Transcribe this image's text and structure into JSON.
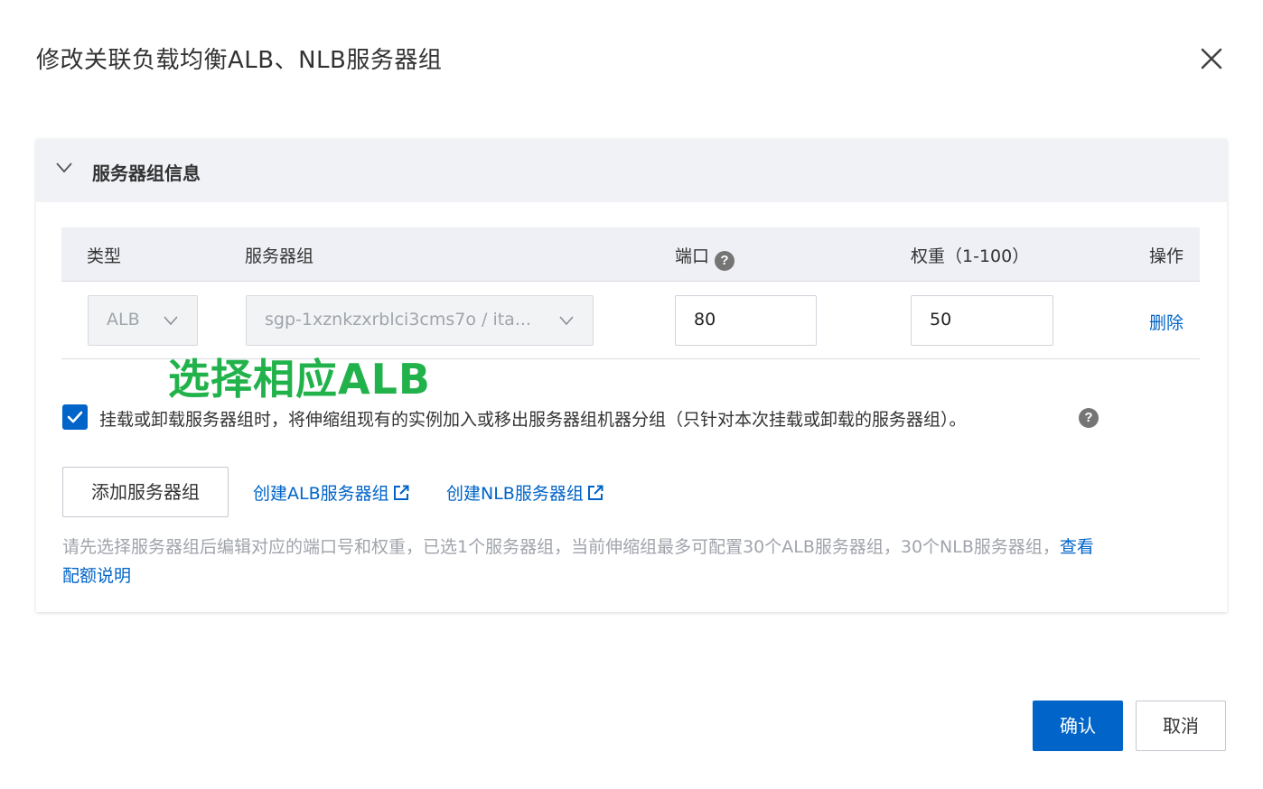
{
  "dialog": {
    "title": "修改关联负载均衡ALB、NLB服务器组",
    "close_icon": "close-icon"
  },
  "panel": {
    "title": "服务器组信息",
    "collapse_icon": "chevron-down-icon"
  },
  "table": {
    "headers": {
      "type": "类型",
      "server_group": "服务器组",
      "port": "端口",
      "weight": "权重（1-100）",
      "action": "操作"
    },
    "rows": [
      {
        "type": "ALB",
        "server_group": "sgp-1xznkzxrblci3cms7o / ita...",
        "port": "80",
        "weight": "50",
        "action": "删除"
      }
    ]
  },
  "annotation": "选择相应ALB",
  "checkbox": {
    "checked": true,
    "label": "挂载或卸载服务器组时，将伸缩组现有的实例加入或移出服务器组机器分组（只针对本次挂载或卸载的服务器组）。"
  },
  "actions": {
    "add_label": "添加服务器组",
    "create_alb": "创建ALB服务器组",
    "create_nlb": "创建NLB服务器组"
  },
  "note": {
    "text": "请先选择服务器组后编辑对应的端口号和权重，已选1个服务器组，当前伸缩组最多可配置30个ALB服务器组，30个NLB服务器组，",
    "link_part1": "查看",
    "link_part2": "配额说明"
  },
  "footer": {
    "confirm": "确认",
    "cancel": "取消"
  },
  "colors": {
    "primary": "#0064c8",
    "annotation": "#22b24c",
    "panel_header_bg": "#f0f2f6"
  }
}
